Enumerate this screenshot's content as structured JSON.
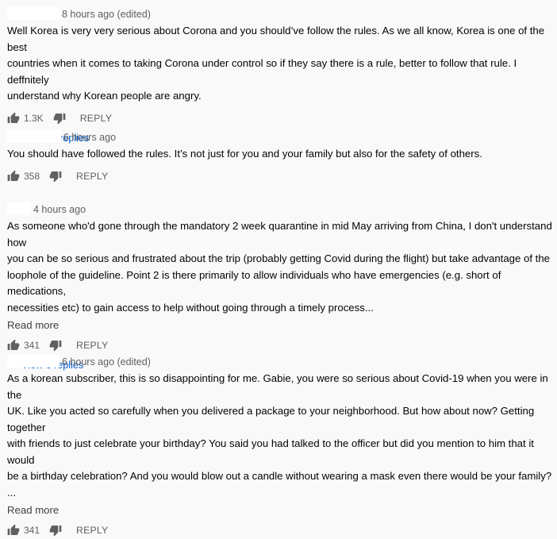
{
  "comments": [
    {
      "timestamp": "8 hours ago (edited)",
      "lines": [
        "Well Korea is very very serious about Corona and you should’ve follow the rules. As we all know, Korea is one of the best",
        "countries when it comes to taking Corona under control so if they say there is a rule, better to follow that rule. I deffnitely",
        "understand why Korean people are angry."
      ],
      "likes": "1.3K",
      "reply_label": "REPLY",
      "view_replies": "View 40 replies"
    },
    {
      "timestamp": "6 hours ago",
      "lines": [
        "You should have followed the rules. It’s not just for you and your family but also for the safety of others."
      ],
      "likes": "358",
      "reply_label": "REPLY"
    },
    {
      "timestamp": "4 hours ago",
      "lines": [
        "As someone who'd gone through the mandatory 2 week quarantine in mid May arriving from China, I don't understand how",
        "you can be so serious and frustrated about the trip (probably getting Covid during the flight) but take advantage of the",
        "loophole of the guideline. Point 2 is there primarily to allow individuals who have emergencies (e.g. short of medications,",
        "necessities etc) to gain access to help without going through a timely process..."
      ],
      "read_more": "Read more",
      "likes": "341",
      "reply_label": "REPLY",
      "view_replies": "View 6 replies"
    },
    {
      "timestamp": "6 hours ago (edited)",
      "lines": [
        "As a korean subscriber, this is so disappointing for me. Gabie, you were so serious about Covid-19 when you were in the",
        "UK. Like you acted so carefully when you delivered a package to your neighborhood. But how about now? Getting together",
        "with friends to just celebrate your birthday? You said you had talked to the officer but did you mention to him that it would",
        "be a birthday celebration? And you would blow out a candle without wearing a mask even there would be your family? ..."
      ],
      "read_more": "Read more",
      "likes": "341",
      "reply_label": "REPLY"
    }
  ],
  "icons": {
    "like": "thumbs-up-icon",
    "dislike": "thumbs-down-icon",
    "expand": "caret-down-icon"
  },
  "colors": {
    "background": "#f9f9f9",
    "link_blue": "#065fd4",
    "secondary_text": "#606060"
  }
}
